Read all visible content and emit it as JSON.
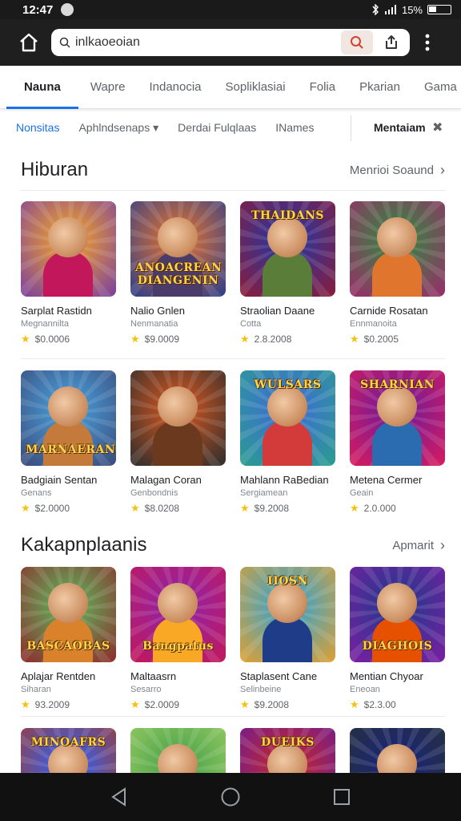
{
  "status": {
    "time": "12:47",
    "signal_text": "15%"
  },
  "browser": {
    "url": "inlkaoeoian",
    "icons": [
      "home-icon",
      "search-icon",
      "share-icon",
      "more-vert-icon"
    ]
  },
  "tabs": [
    "Nauna",
    "Wapre",
    "Indanocia",
    "Sopliklasiai",
    "Folia",
    "Pkarian",
    "Gama"
  ],
  "filters": {
    "items": [
      "Nonsitas",
      "Aphlndsenaps",
      "Derdai Fulqlaas",
      "INames"
    ],
    "mention": "Mentaiam"
  },
  "sections": [
    {
      "title": "Hiburan",
      "more": "Menrioi Soaund",
      "rows": [
        [
          {
            "name": "Sarplat Rastidn",
            "dev": "Megnannilta",
            "rating": "$0.0006",
            "palette": [
              "#f5a623",
              "#c2185b",
              "#7b3fa0"
            ]
          },
          {
            "name": "Nalio Gnlen",
            "dev": "Nenmanatia",
            "rating": "$9.0009",
            "palette": [
              "#e8742a",
              "#4a3b6b",
              "#2c3e8c"
            ],
            "logo": "ANOACREAN DIANGENIN"
          },
          {
            "name": "Straolian Daane",
            "dev": "Cotta",
            "rating": "2.8.2008",
            "palette": [
              "#2038a8",
              "#5a7d3a",
              "#8b1c3a"
            ],
            "logo": "THAIDANS",
            "logo_pos": "top"
          },
          {
            "name": "Carnide Rosatan",
            "dev": "Ennmanoita",
            "rating": "$0.2005",
            "palette": [
              "#2e8b3e",
              "#e0752d",
              "#9b2c6a"
            ]
          }
        ],
        [
          {
            "name": "Badgiain Sentan",
            "dev": "Genans",
            "rating": "$2.0000",
            "palette": [
              "#4aa3df",
              "#c47a3b",
              "#3a4a7a"
            ],
            "logo": "MARNAERAN"
          },
          {
            "name": "Malagan Coran",
            "dev": "Genbondnis",
            "rating": "$8.0208",
            "palette": [
              "#d9581f",
              "#6b3a1e",
              "#2d2d2d"
            ]
          },
          {
            "name": "Mahlann RaBedian",
            "dev": "Sergiamean",
            "rating": "$9.2008",
            "palette": [
              "#3f6ad8",
              "#d33b3b",
              "#2a9d8f"
            ],
            "logo": "WULSARS",
            "logo_pos": "top"
          },
          {
            "name": "Metena Cermer",
            "dev": "Geain",
            "rating": "2.0.000",
            "palette": [
              "#6a1b9a",
              "#2b6cb0",
              "#d81b60"
            ],
            "logo": "SHARNIAN",
            "logo_pos": "top"
          }
        ]
      ]
    },
    {
      "title": "Kakapnplaanis",
      "more": "Apmarit",
      "rows": [
        [
          {
            "name": "Aplajar Rentden",
            "dev": "Siharan",
            "rating": "93.2009",
            "palette": [
              "#5cb85c",
              "#d9822b",
              "#8e2c2c"
            ],
            "logo": "BASCAOBAS"
          },
          {
            "name": "Maltaasrn",
            "dev": "Sesarro",
            "rating": "$2.0009",
            "palette": [
              "#8e24aa",
              "#f9a825",
              "#c2185b"
            ],
            "logo": "Bangpatus"
          },
          {
            "name": "Staplasent Cane",
            "dev": "Selinbeine",
            "rating": "$9.2008",
            "palette": [
              "#29a3d9",
              "#1f3c88",
              "#e0a030"
            ],
            "logo": "IIOSN",
            "logo_pos": "top"
          },
          {
            "name": "Mentian Chyoar",
            "dev": "Eneoan",
            "rating": "$2.3.00",
            "palette": [
              "#1e3a8a",
              "#e65100",
              "#7b1fa2"
            ],
            "logo": "DIAGHOIS"
          }
        ],
        [
          {
            "name": "",
            "dev": "",
            "rating": "",
            "palette": [
              "#2962ff",
              "#f4a340",
              "#a33b2b"
            ],
            "logo": "MINOAFRS",
            "logo_pos": "top"
          },
          {
            "name": "",
            "dev": "",
            "rating": "",
            "palette": [
              "#43a047",
              "#2e7d32",
              "#9ccc65"
            ]
          },
          {
            "name": "",
            "dev": "",
            "rating": "",
            "palette": [
              "#c62828",
              "#ff8f00",
              "#6a1b9a"
            ],
            "logo": "DUEIKS",
            "logo_pos": "top"
          },
          {
            "name": "",
            "dev": "",
            "rating": "",
            "palette": [
              "#1a237e",
              "#37474f",
              "#263238"
            ]
          }
        ]
      ]
    }
  ],
  "nav": [
    "back-icon",
    "home-circle-icon",
    "recents-icon"
  ]
}
